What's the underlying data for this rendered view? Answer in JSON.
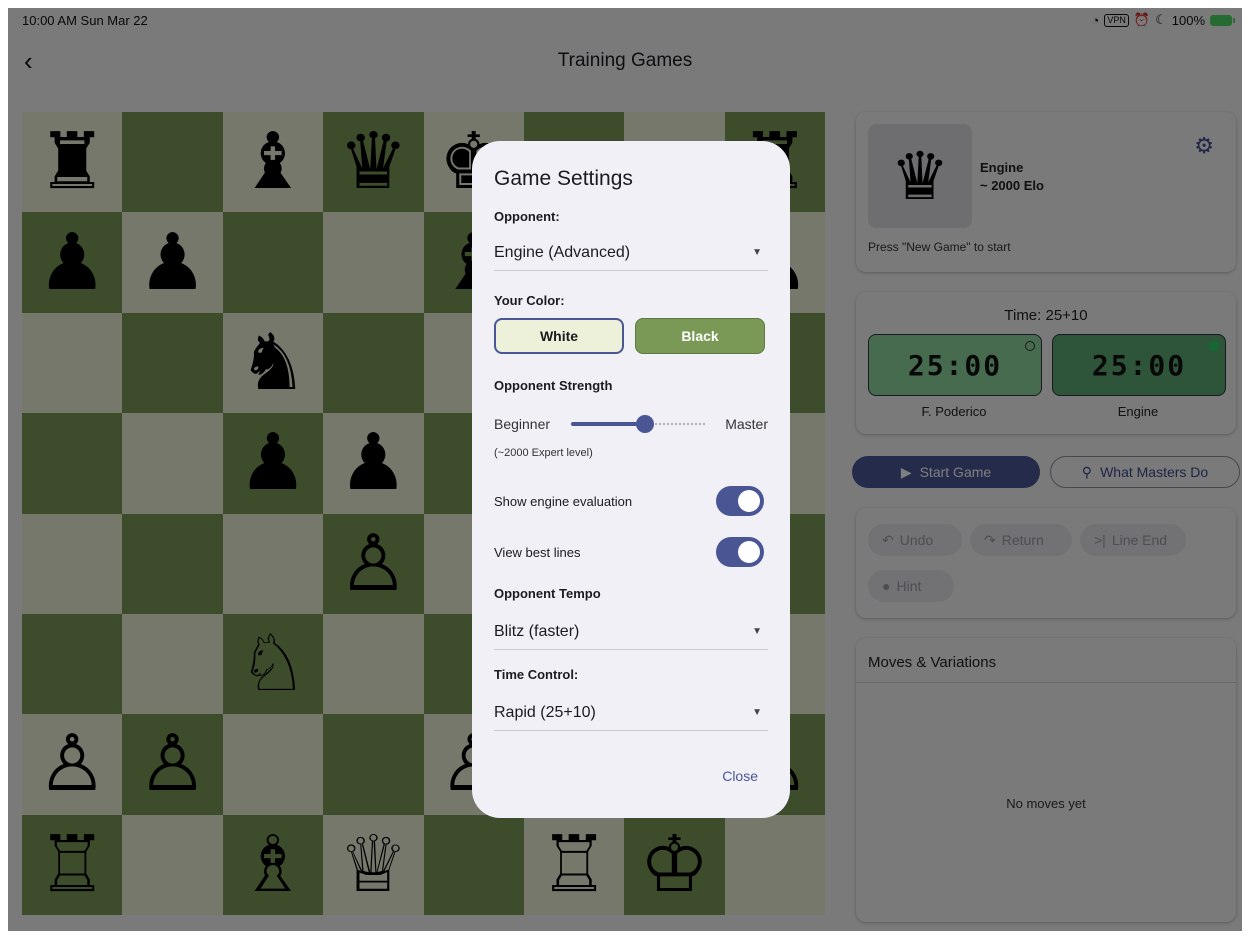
{
  "status": {
    "time": "10:00 AM  Sun Mar 22",
    "vpn": "VPN",
    "battery": "100%"
  },
  "header": {
    "title": "Training Games"
  },
  "board": {
    "rows": [
      [
        "♜",
        "",
        "♝",
        "♛",
        "♚",
        "",
        "",
        "♜"
      ],
      [
        "♟",
        "♟",
        "",
        "",
        "♝",
        "",
        "",
        "♟"
      ],
      [
        "",
        "",
        "♞",
        "",
        "",
        "",
        "",
        ""
      ],
      [
        "",
        "",
        "♟",
        "♟",
        "",
        "",
        "",
        ""
      ],
      [
        "",
        "",
        "",
        "♙",
        "",
        "",
        "",
        ""
      ],
      [
        "",
        "",
        "♘",
        "",
        "",
        "",
        "",
        ""
      ],
      [
        "♙",
        "♙",
        "",
        "",
        "♙",
        "",
        "",
        "♙"
      ],
      [
        "♖",
        "",
        "♗",
        "♕",
        "",
        "♖",
        "♔",
        ""
      ]
    ]
  },
  "engine_card": {
    "queen_glyph": "♛",
    "name": "Engine",
    "elo": "~ 2000 Elo",
    "message": "Press \"New Game\" to start"
  },
  "time_card": {
    "label": "Time: 25+10",
    "clock_white": "25:00",
    "clock_black": "25:00",
    "player_white": "F. Poderico",
    "player_black": "Engine"
  },
  "buttons": {
    "start": "Start Game",
    "masters": "What Masters Do"
  },
  "actions": {
    "undo": "Undo",
    "return": "Return",
    "line_end": "Line End",
    "hint": "Hint"
  },
  "moves": {
    "title": "Moves & Variations",
    "empty": "No moves yet"
  },
  "dialog": {
    "title": "Game Settings",
    "opponent_label": "Opponent:",
    "opponent_value": "Engine (Advanced)",
    "color_label": "Your Color:",
    "color_white": "White",
    "color_black": "Black",
    "strength_label": "Opponent Strength",
    "strength_min": "Beginner",
    "strength_max": "Master",
    "strength_level": 0.55,
    "strength_desc": "(~2000 Expert level)",
    "show_eval": "Show engine evaluation",
    "view_lines": "View best lines",
    "tempo_label": "Opponent Tempo",
    "tempo_value": "Blitz (faster)",
    "time_label": "Time Control:",
    "time_value": "Rapid (25+10)",
    "close": "Close"
  },
  "colors": {
    "accent": "#4a5694",
    "board_light": "#eef1d9",
    "board_dark": "#7a9956"
  }
}
